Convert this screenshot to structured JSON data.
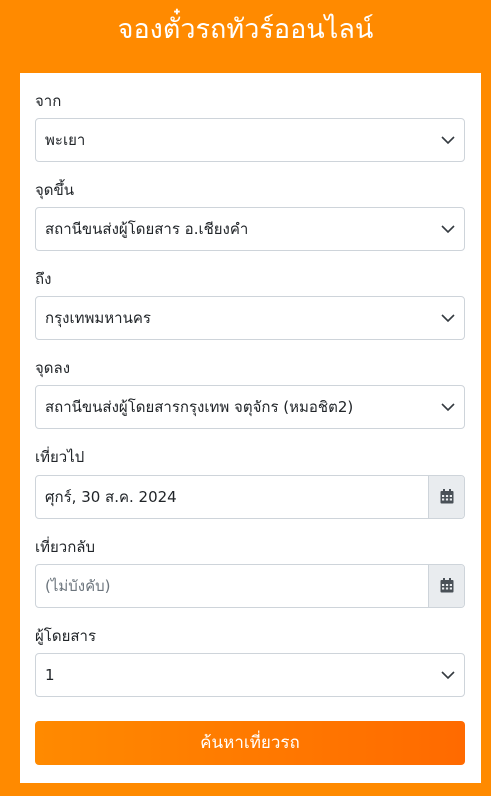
{
  "page": {
    "title": "จองตั๋วรถทัวร์ออนไลน์"
  },
  "form": {
    "from": {
      "label": "จาก",
      "value": "พะเยา"
    },
    "pickup": {
      "label": "จุดขึ้น",
      "value": "สถานีขนส่งผู้โดยสาร อ.เชียงคำ"
    },
    "to": {
      "label": "ถึง",
      "value": "กรุงเทพมหานคร"
    },
    "dropoff": {
      "label": "จุดลง",
      "value": "สถานีขนส่งผู้โดยสารกรุงเทพ จตุจักร (หมอชิต2)"
    },
    "depart": {
      "label": "เที่ยวไป",
      "value": "ศุกร์, 30 ส.ค. 2024"
    },
    "return": {
      "label": "เที่ยวกลับ",
      "placeholder": "(ไม่บังคับ)"
    },
    "passengers": {
      "label": "ผู้โดยสาร",
      "value": "1"
    },
    "search_label": "ค้นหาเที่ยวรถ"
  },
  "colors": {
    "background": "#ff8a00",
    "button": "#ff6a00"
  },
  "icons": {
    "select": "chevron-down-icon",
    "date": "calendar-icon"
  }
}
